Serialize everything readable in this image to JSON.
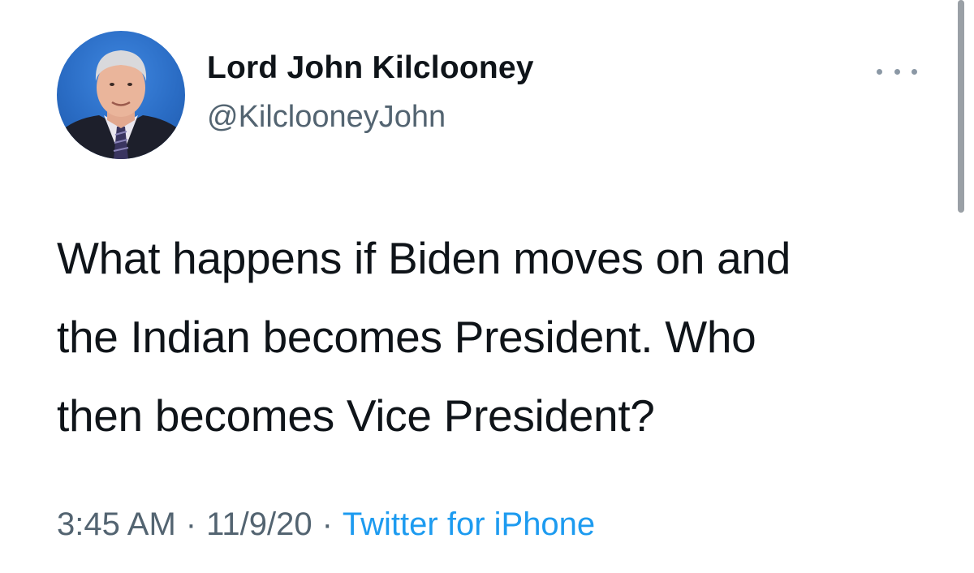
{
  "author": {
    "display_name": "Lord John Kilclooney",
    "handle": "@KilclooneyJohn",
    "avatar_icon": "profile-photo"
  },
  "more_icon": "more-options-icon",
  "tweet": {
    "lines": [
      "What happens if Biden moves on and",
      "the Indian becomes President. Who",
      "then becomes Vice President?"
    ]
  },
  "meta": {
    "time": "3:45 AM",
    "separator": "·",
    "date": "11/9/20",
    "source": "Twitter for iPhone"
  },
  "colors": {
    "text": "#0f1419",
    "secondary": "#536471",
    "link": "#1d9bf0",
    "avatar_bg": "#2a6cc4"
  }
}
